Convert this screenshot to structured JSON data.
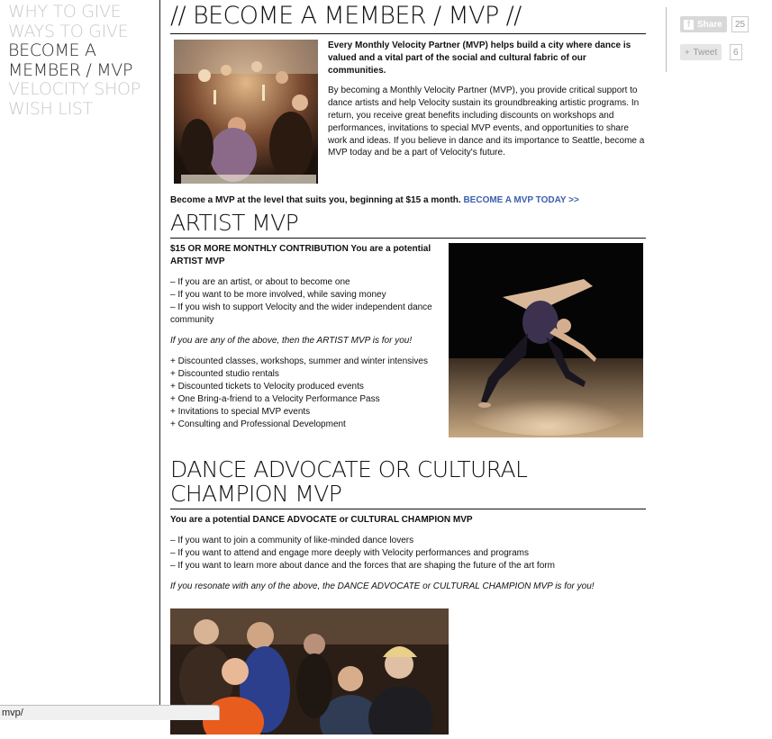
{
  "nav": {
    "items": [
      {
        "label": "WHY TO GIVE",
        "active": false
      },
      {
        "label": "WAYS TO GIVE",
        "active": false
      },
      {
        "label": "BECOME A MEMBER / MVP",
        "active": true
      },
      {
        "label": "VELOCITY SHOP",
        "active": false
      },
      {
        "label": "WISH LIST",
        "active": false
      }
    ]
  },
  "page": {
    "title": "// BECOME A MEMBER / MVP //",
    "intro_lead": "Every Monthly Velocity Partner (MVP) helps build a city where dance is valued and a vital part of the social and cultural fabric of our communities.",
    "intro_body": "By becoming a Monthly Velocity Partner (MVP), you provide critical support to dance artists and help Velocity sustain its groundbreaking artistic programs. In return, you receive great benefits including discounts on workshops and performances, invitations to special MVP events, and opportunities to share work and ideas. If you believe in dance and its importance to Seattle, become a MVP today and be a part of Velocity's future.",
    "levels_text": "Become a MVP at the level that suits you, beginning at $15 a month.",
    "levels_link": "BECOME A MVP TODAY >>"
  },
  "artist": {
    "heading": "ARTIST MVP",
    "lead": "$15 OR MORE MONTHLY CONTRIBUTION You are a potential ARTIST MVP",
    "conditions": [
      "– If you are an artist, or about to become one",
      "– If you want to be more involved, while saving money",
      "– If you wish to support Velocity and the wider independent dance community"
    ],
    "note": "If you are any of the above, then the ARTIST MVP is for you!",
    "benefits": [
      "+ Discounted classes, workshops, summer and winter intensives",
      "+ Discounted studio rentals",
      "+ Discounted tickets to Velocity produced events",
      "+ One Bring-a-friend to a Velocity Performance Pass",
      "+ Invitations to special MVP events",
      "+ Consulting and Professional Development"
    ]
  },
  "advocate": {
    "heading": "DANCE ADVOCATE OR CULTURAL CHAMPION MVP",
    "lead": "You are a potential DANCE ADVOCATE or CULTURAL CHAMPION MVP",
    "conditions": [
      "– If you want to join a community of like-minded dance lovers",
      "– If you want to attend and engage more deeply with Velocity performances and programs",
      "– If you want to learn more about dance and the forces that are shaping the future of the art form"
    ],
    "note": "If you resonate with any of the above, the DANCE ADVOCATE or CULTURAL CHAMPION MVP is for you!"
  },
  "social": {
    "share_label": "Share",
    "share_count": "25",
    "tweet_label": "Tweet",
    "tweet_count": "6"
  },
  "status_bar": {
    "text": "mvp/"
  },
  "colors": {
    "link": "#3c5fae",
    "nav_inactive": "#c9c9c9",
    "nav_active": "#2a2a2a"
  }
}
